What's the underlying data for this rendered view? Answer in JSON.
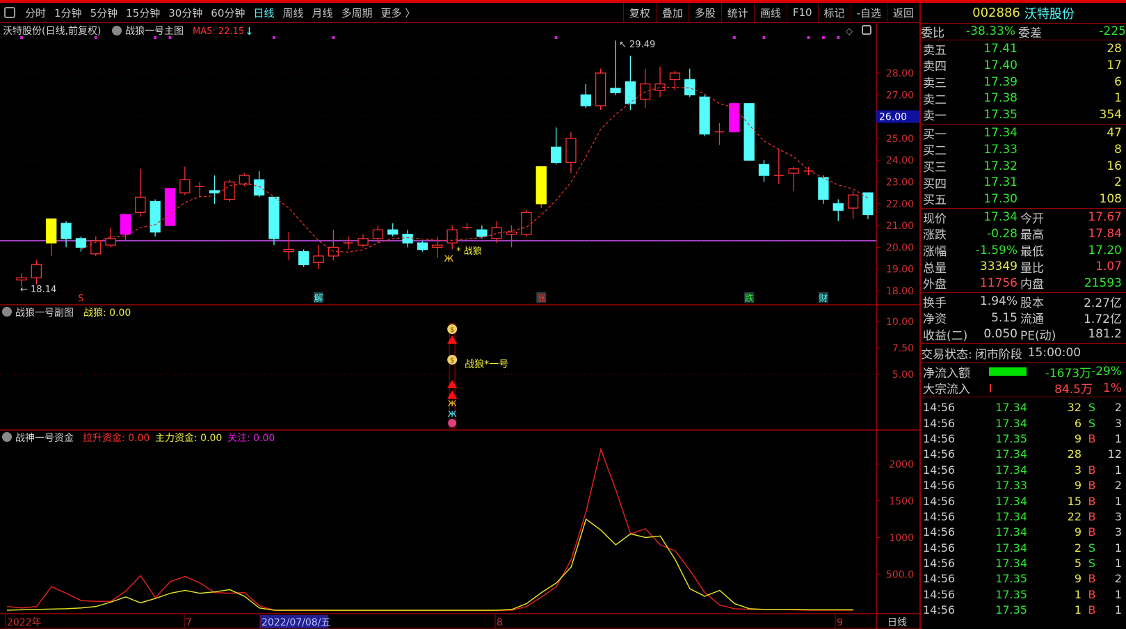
{
  "toolbar": {
    "periods": [
      "分时",
      "1分钟",
      "5分钟",
      "15分钟",
      "30分钟",
      "60分钟",
      "日线",
      "周线",
      "月线",
      "多周期",
      "更多 〉"
    ],
    "active": "日线",
    "actions": [
      "复权",
      "叠加",
      "多股",
      "统计",
      "画线",
      "F10",
      "标记",
      "-自选",
      "返回"
    ]
  },
  "main": {
    "title": "沃特股份(日线,前复权)",
    "indicator": "战狼一号主图",
    "ma5": "MA5: 22.15",
    "ma5_arrow": "↓",
    "high_label": "29.49",
    "low_label": "18.14",
    "signal_label": "* 战狼",
    "price_ticks": [
      "28.00",
      "27.00",
      "26.00",
      "25.00",
      "24.00",
      "23.00",
      "22.00",
      "21.00",
      "20.00",
      "19.00",
      "18.00"
    ],
    "cursor_price": "26.00",
    "markers": [
      {
        "text": "S",
        "color": "#ff3030",
        "i": 4
      },
      {
        "text": "解",
        "color": "#54fcfc",
        "i": 20
      },
      {
        "text": "涨",
        "color": "#ff3030",
        "i": 35
      },
      {
        "text": "跌",
        "color": "#2ee82e",
        "i": 49
      },
      {
        "text": "财",
        "color": "#54fcfc",
        "i": 54
      }
    ]
  },
  "sub": {
    "title": "战狼一号副图",
    "value": "战狼: 0.00",
    "label": "战狼*一号",
    "ticks": [
      "10.00",
      "7.50",
      "5.00"
    ]
  },
  "money": {
    "title": "战神一号资金",
    "v1": "拉升资金: 0.00",
    "v2": "主力资金: 0.00",
    "v3": "关注: 0.00",
    "ticks": [
      "2000",
      "1500",
      "1000",
      "500.0"
    ]
  },
  "xaxis": {
    "labels": [
      "2022年",
      "7",
      "2022/07/08/五",
      "8",
      "9"
    ],
    "period": "日线"
  },
  "chart_data": {
    "type": "candlestick",
    "ohlc": [
      [
        18.5,
        18.2,
        18.8,
        18.6
      ],
      [
        18.6,
        18.3,
        19.4,
        19.2
      ],
      [
        20.2,
        19.6,
        21.3,
        21.3
      ],
      [
        21.1,
        20.0,
        21.2,
        20.4
      ],
      [
        20.4,
        19.8,
        20.5,
        20.0
      ],
      [
        19.7,
        19.6,
        20.5,
        20.3
      ],
      [
        20.1,
        20.0,
        20.9,
        20.4
      ],
      [
        20.6,
        20.3,
        21.5,
        21.5
      ],
      [
        21.6,
        21.4,
        23.6,
        22.3
      ],
      [
        22.1,
        20.5,
        22.2,
        20.7
      ],
      [
        21.0,
        21.0,
        22.7,
        22.7
      ],
      [
        22.5,
        22.4,
        23.7,
        23.1
      ],
      [
        22.8,
        22.3,
        23.0,
        22.8
      ],
      [
        22.6,
        22.0,
        23.3,
        22.5
      ],
      [
        22.2,
        22.1,
        23.1,
        23.0
      ],
      [
        22.9,
        22.8,
        23.4,
        23.3
      ],
      [
        23.1,
        22.3,
        23.5,
        22.4
      ],
      [
        22.3,
        20.1,
        22.3,
        20.4
      ],
      [
        19.8,
        19.4,
        20.7,
        19.9
      ],
      [
        19.8,
        19.1,
        19.9,
        19.2
      ],
      [
        19.3,
        19.0,
        20.1,
        19.6
      ],
      [
        19.6,
        19.4,
        20.8,
        20.0
      ],
      [
        20.2,
        19.9,
        20.5,
        20.2
      ],
      [
        20.1,
        20.0,
        20.6,
        20.4
      ],
      [
        20.4,
        20.2,
        21.0,
        20.8
      ],
      [
        20.8,
        20.5,
        21.1,
        20.6
      ],
      [
        20.6,
        20.0,
        20.8,
        20.2
      ],
      [
        20.2,
        19.8,
        20.3,
        19.9
      ],
      [
        20.0,
        19.5,
        20.5,
        20.1
      ],
      [
        20.2,
        19.9,
        21.0,
        20.8
      ],
      [
        20.9,
        20.8,
        21.1,
        20.9
      ],
      [
        20.8,
        20.4,
        21.0,
        20.5
      ],
      [
        20.4,
        20.2,
        21.2,
        20.9
      ],
      [
        20.6,
        20.0,
        21.0,
        20.7
      ],
      [
        20.6,
        20.5,
        21.7,
        21.6
      ],
      [
        22.0,
        21.8,
        23.7,
        23.7
      ],
      [
        24.6,
        23.8,
        25.5,
        23.9
      ],
      [
        23.9,
        23.4,
        25.3,
        25.0
      ],
      [
        27.0,
        26.4,
        27.5,
        26.5
      ],
      [
        26.5,
        26.3,
        28.2,
        28.0
      ],
      [
        27.3,
        27.0,
        29.49,
        27.1
      ],
      [
        27.6,
        26.3,
        28.8,
        26.6
      ],
      [
        26.8,
        26.4,
        28.2,
        27.5
      ],
      [
        27.2,
        26.9,
        28.3,
        27.5
      ],
      [
        27.7,
        27.2,
        28.1,
        28.0
      ],
      [
        27.7,
        26.9,
        28.2,
        27.0
      ],
      [
        26.9,
        25.1,
        27.0,
        25.2
      ],
      [
        25.3,
        24.7,
        25.7,
        25.3
      ],
      [
        25.3,
        25.3,
        26.6,
        26.6
      ],
      [
        26.6,
        24.0,
        26.6,
        24.0
      ],
      [
        23.8,
        23.0,
        24.0,
        23.3
      ],
      [
        23.3,
        22.9,
        24.5,
        23.3
      ],
      [
        23.4,
        22.6,
        23.7,
        23.6
      ],
      [
        23.5,
        23.3,
        23.7,
        23.5
      ],
      [
        23.2,
        22.0,
        23.3,
        22.2
      ],
      [
        22.0,
        21.2,
        22.2,
        21.7
      ],
      [
        21.8,
        21.3,
        22.6,
        22.4
      ],
      [
        22.5,
        21.3,
        22.5,
        21.5
      ]
    ],
    "highlight": {
      "2": "#ffff00",
      "7": "#ff00ff",
      "10": "#ff00ff",
      "35": "#ffff00",
      "48": "#ff00ff"
    },
    "ylim": [
      17.6,
      30
    ],
    "money_series": [
      {
        "name": "拉升资金",
        "color": "#e02020",
        "values": [
          60,
          40,
          60,
          330,
          240,
          140,
          130,
          130,
          270,
          480,
          180,
          400,
          470,
          380,
          250,
          240,
          250,
          70,
          10,
          5,
          5,
          5,
          5,
          5,
          5,
          5,
          5,
          5,
          5,
          5,
          5,
          5,
          5,
          5,
          10,
          60,
          190,
          330,
          700,
          1350,
          2200,
          1650,
          1050,
          1120,
          900,
          820,
          550,
          250,
          80,
          30,
          20,
          20,
          20,
          15,
          10,
          10,
          10,
          10
        ]
      },
      {
        "name": "主力资金",
        "color": "#e0e020",
        "values": [
          10,
          15,
          20,
          25,
          30,
          40,
          60,
          120,
          190,
          110,
          170,
          240,
          280,
          240,
          260,
          290,
          200,
          40,
          10,
          10,
          10,
          10,
          10,
          10,
          10,
          10,
          10,
          10,
          10,
          10,
          10,
          10,
          10,
          10,
          20,
          100,
          250,
          380,
          600,
          1250,
          1100,
          900,
          1050,
          1000,
          1020,
          700,
          300,
          200,
          280,
          100,
          30,
          20,
          20,
          20,
          15,
          15,
          15,
          15
        ]
      }
    ],
    "money_ylim": [
      0,
      2300
    ]
  },
  "quote": {
    "code": "002886",
    "name": "沃特股份",
    "wb": {
      "l": "委比",
      "v": "-38.33%",
      "l2": "委差",
      "v2": "-225"
    },
    "asks": [
      [
        "卖五",
        "17.41",
        "28"
      ],
      [
        "卖四",
        "17.40",
        "17"
      ],
      [
        "卖三",
        "17.39",
        "6"
      ],
      [
        "卖二",
        "17.38",
        "1"
      ],
      [
        "卖一",
        "17.35",
        "354"
      ]
    ],
    "bids": [
      [
        "买一",
        "17.34",
        "47"
      ],
      [
        "买二",
        "17.33",
        "8"
      ],
      [
        "买三",
        "17.32",
        "16"
      ],
      [
        "买四",
        "17.31",
        "2"
      ],
      [
        "买五",
        "17.30",
        "108"
      ]
    ],
    "stats": [
      [
        "现价",
        "17.34",
        "g",
        "今开",
        "17.67",
        "r"
      ],
      [
        "涨跌",
        "-0.28",
        "g",
        "最高",
        "17.84",
        "r"
      ],
      [
        "涨幅",
        "-1.59%",
        "g",
        "最低",
        "17.20",
        "g"
      ],
      [
        "总量",
        "33349",
        "y",
        "量比",
        "1.07",
        "r"
      ],
      [
        "外盘",
        "11756",
        "r",
        "内盘",
        "21593",
        "g"
      ]
    ],
    "fund": [
      [
        "换手",
        "1.94%",
        "股本",
        "2.27亿"
      ],
      [
        "净资",
        "5.15",
        "流通",
        "1.72亿"
      ],
      [
        "收益(二)",
        "0.050",
        "PE(动)",
        "181.2"
      ]
    ],
    "status_label": "交易状态:",
    "status": "闭市阶段",
    "time": "15:00:00",
    "flow": [
      {
        "l": "净流入额",
        "v": "-1673万",
        "p": "-29%",
        "bar": 0.9,
        "color": "#00e000"
      },
      {
        "l": "大宗流入",
        "v": "84.5万",
        "p": "1%",
        "bar": 0.03,
        "color": "#ff3030"
      }
    ]
  },
  "trades": [
    [
      "14:56",
      "17.34",
      "32",
      "S",
      "2"
    ],
    [
      "14:56",
      "17.34",
      "6",
      "S",
      "3"
    ],
    [
      "14:56",
      "17.35",
      "9",
      "B",
      "1"
    ],
    [
      "14:56",
      "17.34",
      "28",
      "",
      "12"
    ],
    [
      "14:56",
      "17.34",
      "3",
      "B",
      "1"
    ],
    [
      "14:56",
      "17.33",
      "9",
      "B",
      "2"
    ],
    [
      "14:56",
      "17.34",
      "15",
      "B",
      "1"
    ],
    [
      "14:56",
      "17.34",
      "22",
      "B",
      "3"
    ],
    [
      "14:56",
      "17.34",
      "9",
      "B",
      "3"
    ],
    [
      "14:56",
      "17.34",
      "2",
      "S",
      "1"
    ],
    [
      "14:56",
      "17.34",
      "5",
      "S",
      "1"
    ],
    [
      "14:56",
      "17.35",
      "9",
      "B",
      "2"
    ],
    [
      "14:56",
      "17.35",
      "1",
      "B",
      "1"
    ],
    [
      "14:56",
      "17.35",
      "1",
      "B",
      "1"
    ]
  ]
}
